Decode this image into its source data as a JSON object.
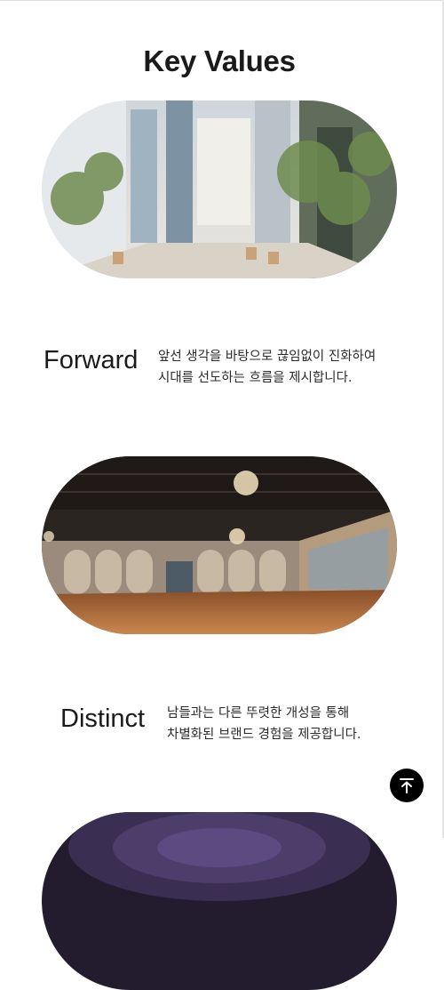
{
  "section": {
    "title": "Key Values"
  },
  "values": [
    {
      "name": "Forward",
      "desc_lines": [
        "앞선 생각을 바탕으로 끊임없이 진화하여",
        "시대를 선도하는 흐름을 제시합니다."
      ]
    },
    {
      "name": "Distinct",
      "desc_lines": [
        "남들과는 다른 뚜렷한 개성을 통해",
        "차별화된 브랜드 경험을 제공합니다."
      ]
    }
  ],
  "images": [
    {
      "icon": "atrium-photo"
    },
    {
      "icon": "ballroom-photo"
    },
    {
      "icon": "dome-hall-photo"
    }
  ],
  "controls": {
    "scroll_top_icon": "arrow-up-to-top-icon"
  },
  "colors": {
    "text": "#1a1a1a",
    "button": "#000000"
  }
}
